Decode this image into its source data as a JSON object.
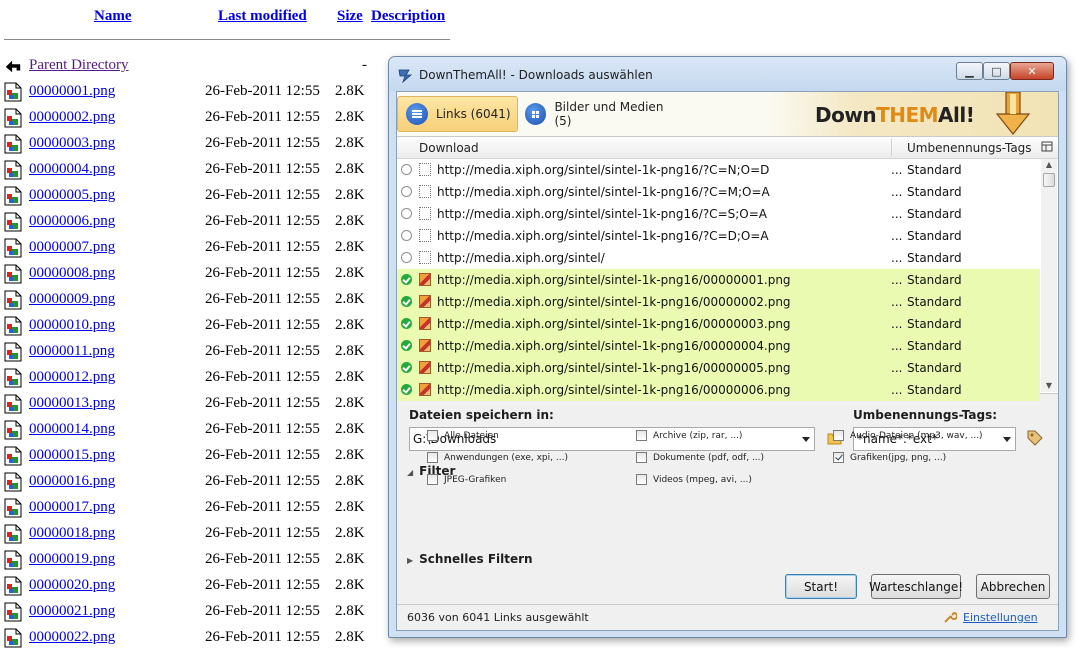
{
  "listing": {
    "headers": {
      "name": "Name",
      "last_modified": "Last modified",
      "size": "Size",
      "description": "Description"
    },
    "parent": {
      "name": "Parent Directory",
      "size": "-"
    },
    "rows": [
      {
        "name": "00000001.png",
        "date": "26-Feb-2011 12:55",
        "size": "2.8K"
      },
      {
        "name": "00000002.png",
        "date": "26-Feb-2011 12:55",
        "size": "2.8K"
      },
      {
        "name": "00000003.png",
        "date": "26-Feb-2011 12:55",
        "size": "2.8K"
      },
      {
        "name": "00000004.png",
        "date": "26-Feb-2011 12:55",
        "size": "2.8K"
      },
      {
        "name": "00000005.png",
        "date": "26-Feb-2011 12:55",
        "size": "2.8K"
      },
      {
        "name": "00000006.png",
        "date": "26-Feb-2011 12:55",
        "size": "2.8K"
      },
      {
        "name": "00000007.png",
        "date": "26-Feb-2011 12:55",
        "size": "2.8K"
      },
      {
        "name": "00000008.png",
        "date": "26-Feb-2011 12:55",
        "size": "2.8K"
      },
      {
        "name": "00000009.png",
        "date": "26-Feb-2011 12:55",
        "size": "2.8K"
      },
      {
        "name": "00000010.png",
        "date": "26-Feb-2011 12:55",
        "size": "2.8K"
      },
      {
        "name": "00000011.png",
        "date": "26-Feb-2011 12:55",
        "size": "2.8K"
      },
      {
        "name": "00000012.png",
        "date": "26-Feb-2011 12:55",
        "size": "2.8K"
      },
      {
        "name": "00000013.png",
        "date": "26-Feb-2011 12:55",
        "size": "2.8K"
      },
      {
        "name": "00000014.png",
        "date": "26-Feb-2011 12:55",
        "size": "2.8K"
      },
      {
        "name": "00000015.png",
        "date": "26-Feb-2011 12:55",
        "size": "2.8K"
      },
      {
        "name": "00000016.png",
        "date": "26-Feb-2011 12:55",
        "size": "2.8K"
      },
      {
        "name": "00000017.png",
        "date": "26-Feb-2011 12:55",
        "size": "2.8K"
      },
      {
        "name": "00000018.png",
        "date": "26-Feb-2011 12:55",
        "size": "2.8K"
      },
      {
        "name": "00000019.png",
        "date": "26-Feb-2011 12:55",
        "size": "2.8K"
      },
      {
        "name": "00000020.png",
        "date": "26-Feb-2011 12:55",
        "size": "2.8K"
      },
      {
        "name": "00000021.png",
        "date": "26-Feb-2011 12:55",
        "size": "2.8K"
      },
      {
        "name": "00000022.png",
        "date": "26-Feb-2011 12:55",
        "size": "2.8K"
      }
    ]
  },
  "dialog": {
    "title": "DownThemAll! - Downloads auswählen",
    "window_buttons": {
      "minimize": "▁",
      "maximize": "□",
      "close": "✕"
    },
    "tabs": [
      {
        "label": "Links (6041)",
        "active": true,
        "icon": "list-icon"
      },
      {
        "label": "Bilder und Medien (5)",
        "active": false,
        "icon": "grid-icon"
      }
    ],
    "logo": {
      "part1": "Down",
      "part2": "THEM",
      "part3": "All!"
    },
    "columns": {
      "download": "Download",
      "tags": "Umbenennungs-Tags"
    },
    "rows": [
      {
        "url": "http://media.xiph.org/sintel/sintel-1k-png16/?C=N;O=D",
        "tag": "Standard",
        "selected": false
      },
      {
        "url": "http://media.xiph.org/sintel/sintel-1k-png16/?C=M;O=A",
        "tag": "Standard",
        "selected": false
      },
      {
        "url": "http://media.xiph.org/sintel/sintel-1k-png16/?C=S;O=A",
        "tag": "Standard",
        "selected": false
      },
      {
        "url": "http://media.xiph.org/sintel/sintel-1k-png16/?C=D;O=A",
        "tag": "Standard",
        "selected": false
      },
      {
        "url": "http://media.xiph.org/sintel/",
        "tag": "Standard",
        "selected": false
      },
      {
        "url": "http://media.xiph.org/sintel/sintel-1k-png16/00000001.png",
        "tag": "Standard",
        "selected": true
      },
      {
        "url": "http://media.xiph.org/sintel/sintel-1k-png16/00000002.png",
        "tag": "Standard",
        "selected": true
      },
      {
        "url": "http://media.xiph.org/sintel/sintel-1k-png16/00000003.png",
        "tag": "Standard",
        "selected": true
      },
      {
        "url": "http://media.xiph.org/sintel/sintel-1k-png16/00000004.png",
        "tag": "Standard",
        "selected": true
      },
      {
        "url": "http://media.xiph.org/sintel/sintel-1k-png16/00000005.png",
        "tag": "Standard",
        "selected": true
      },
      {
        "url": "http://media.xiph.org/sintel/sintel-1k-png16/00000006.png",
        "tag": "Standard",
        "selected": true
      }
    ],
    "save_in": {
      "label": "Dateien speichern in:",
      "value": "G:\\Downloads"
    },
    "rename": {
      "label": "Umbenennungs-Tags:",
      "value": "*name*.*ext*"
    },
    "filter": {
      "label": "Filter",
      "items": [
        {
          "label": "Alle Dateien",
          "checked": false
        },
        {
          "label": "Archive (zip, rar, ...)",
          "checked": false
        },
        {
          "label": "Audio-Dateien (mp3, wav, ...)",
          "checked": false
        },
        {
          "label": "Anwendungen (exe, xpi, ...)",
          "checked": false
        },
        {
          "label": "Dokumente (pdf, odf, ...)",
          "checked": false
        },
        {
          "label": "Grafiken(jpg, png, ...)",
          "checked": true
        },
        {
          "label": "JPEG-Grafiken",
          "checked": false
        },
        {
          "label": "Videos (mpeg, avi, ...)",
          "checked": false
        }
      ]
    },
    "quick_filter": "Schnelles Filtern",
    "buttons": {
      "start": "Start!",
      "queue": "Warteschlange!",
      "cancel": "Abbrechen"
    },
    "status": "6036 von 6041 Links ausgewählt",
    "settings": "Einstellungen",
    "colors": {
      "selected_row": "#eafbb1",
      "active_tab": "#f7d07a",
      "logo_accent": "#e08a14"
    }
  }
}
